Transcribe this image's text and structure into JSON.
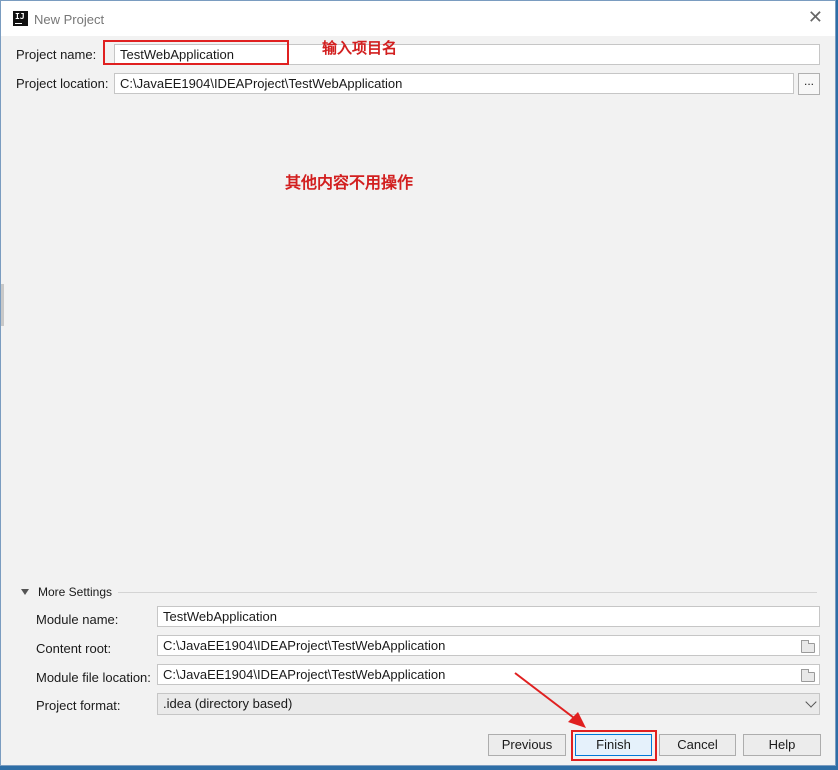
{
  "window": {
    "title": "New Project"
  },
  "project": {
    "name_label": "Project name:",
    "name_value": "TestWebApplication",
    "location_label": "Project location:",
    "location_value": "C:\\JavaEE1904\\IDEAProject\\TestWebApplication",
    "browse_label": "..."
  },
  "annotations": {
    "enter_name": "输入项目名",
    "no_other_changes": "其他内容不用操作"
  },
  "more_settings": {
    "label": "More Settings",
    "module_name_label": "Module name:",
    "module_name_value": "TestWebApplication",
    "content_root_label": "Content root:",
    "content_root_value": "C:\\JavaEE1904\\IDEAProject\\TestWebApplication",
    "module_file_label": "Module file location:",
    "module_file_value": "C:\\JavaEE1904\\IDEAProject\\TestWebApplication",
    "format_label": "Project format:",
    "format_value": ".idea (directory based)"
  },
  "buttons": {
    "previous": "Previous",
    "finish": "Finish",
    "cancel": "Cancel",
    "help": "Help"
  },
  "icons": {
    "app": "intellij-idea-icon",
    "close": "close-icon",
    "folder": "folder-icon",
    "expand": "triangle-down-icon",
    "dropdown": "chevron-down-icon"
  },
  "colors": {
    "annotation": "#d21f1f",
    "accent": "#0078d7"
  }
}
